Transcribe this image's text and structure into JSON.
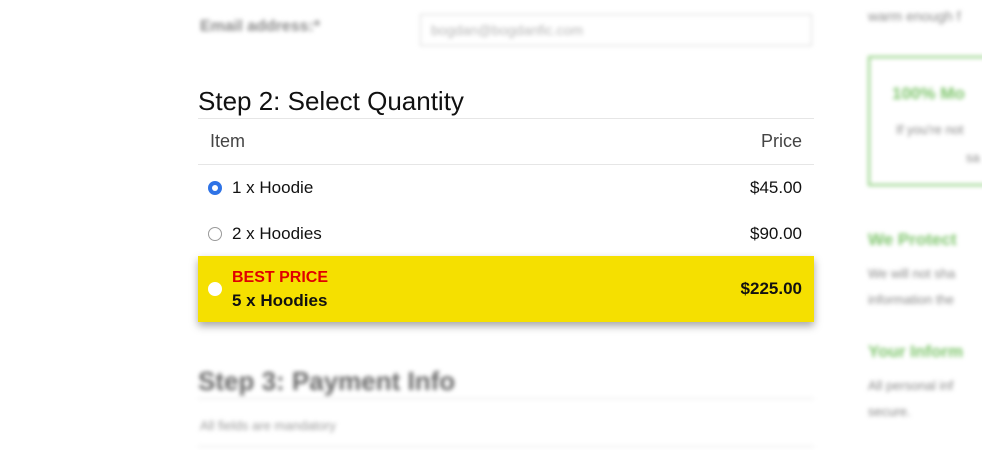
{
  "email": {
    "label": "Email address:*",
    "value": "bogdan@bogdanfic.com"
  },
  "step2": {
    "title": "Step 2: Select Quantity",
    "columns": {
      "item": "Item",
      "price": "Price"
    },
    "options": [
      {
        "label": "1 x Hoodie",
        "price": "$45.00",
        "selected": true
      },
      {
        "label": "2 x Hoodies",
        "price": "$90.00",
        "selected": false
      },
      {
        "tag": "BEST PRICE",
        "label": "5 x Hoodies",
        "price": "$225.00",
        "selected": false
      }
    ]
  },
  "step3": {
    "title": "Step 3: Payment Info",
    "note": "All fields are mandatory"
  },
  "sidebar": {
    "top_text": "warm enough f",
    "box": {
      "title": "100% Mo",
      "line1": "If you're not",
      "line2": "sa"
    },
    "sections": [
      {
        "heading": "We Protect",
        "lines": [
          "We will not sha",
          "information the"
        ]
      },
      {
        "heading": "Your Inform",
        "lines": [
          "All personal inf",
          "secure."
        ]
      }
    ]
  },
  "colors": {
    "highlight": "#f5e000",
    "best_price_text": "#e00000",
    "radio_selected": "#2f73e6",
    "sidebar_accent": "#7cc46a"
  }
}
